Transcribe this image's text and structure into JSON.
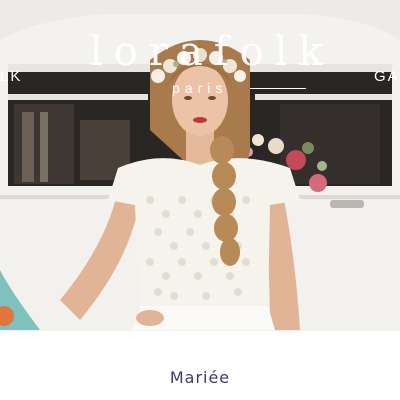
{
  "brand": {
    "logo_text": "lorafolk",
    "subtitle": "paris"
  },
  "nav": {
    "left_fragment": "LK",
    "right_fragment": "GA"
  },
  "hero": {
    "image_subject": "bride-in-lace-dress-with-flower-crown-in-front-of-vintage-van"
  },
  "caption": {
    "label": "Mariée"
  },
  "colors": {
    "caption_text": "#3c3a6e",
    "van_body": "#f2f1ee",
    "van_trim": "#7fc1bd",
    "hair": "#b98a55"
  }
}
